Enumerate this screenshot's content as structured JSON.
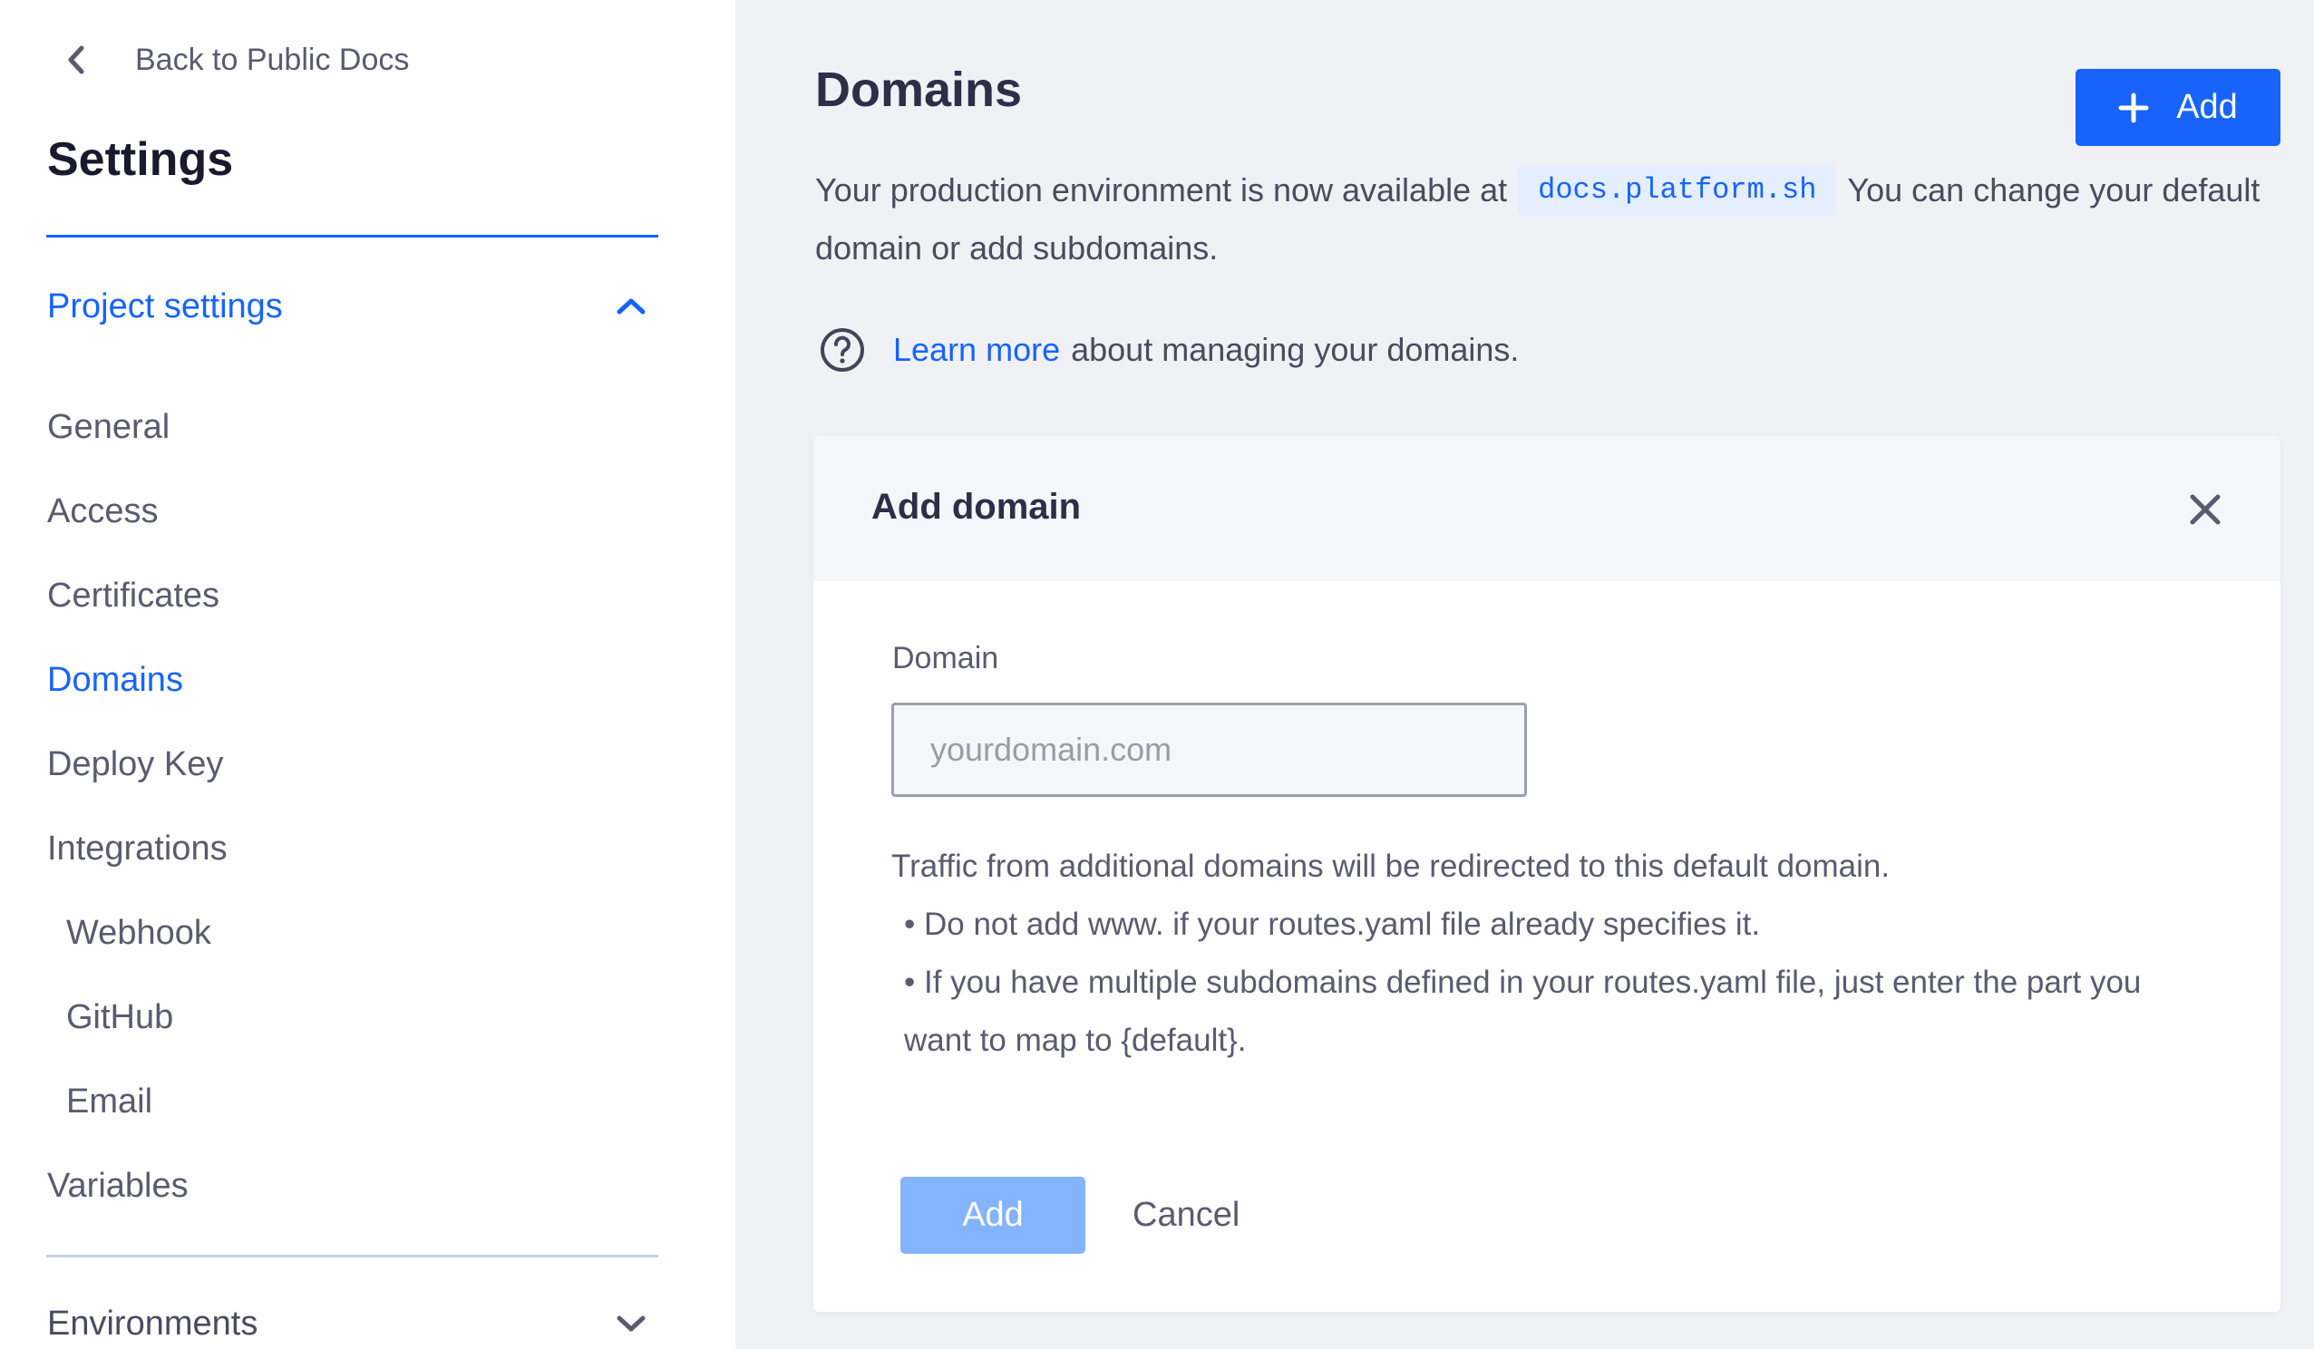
{
  "sidebar": {
    "back_label": "Back to Public Docs",
    "title": "Settings",
    "project_section": {
      "label": "Project settings",
      "expanded": true,
      "items": [
        {
          "label": "General",
          "level": 0,
          "active": false
        },
        {
          "label": "Access",
          "level": 0,
          "active": false
        },
        {
          "label": "Certificates",
          "level": 0,
          "active": false
        },
        {
          "label": "Domains",
          "level": 0,
          "active": true
        },
        {
          "label": "Deploy Key",
          "level": 0,
          "active": false
        },
        {
          "label": "Integrations",
          "level": 0,
          "active": false
        },
        {
          "label": "Webhook",
          "level": 1,
          "active": false
        },
        {
          "label": "GitHub",
          "level": 1,
          "active": false
        },
        {
          "label": "Email",
          "level": 1,
          "active": false
        },
        {
          "label": "Variables",
          "level": 0,
          "active": false
        }
      ]
    },
    "environments_section": {
      "label": "Environments",
      "expanded": false
    }
  },
  "main": {
    "title": "Domains",
    "add_button_label": "Add",
    "intro_before": "Your production environment is now available at",
    "production_domain": "docs.platform.sh",
    "intro_after": "You can change your default domain or add subdomains.",
    "learn_more_link": "Learn more",
    "learn_more_rest": "about managing your domains."
  },
  "add_domain_card": {
    "title": "Add domain",
    "field_label": "Domain",
    "field_value": "",
    "field_placeholder": "yourdomain.com",
    "help_main": "Traffic from additional domains will be redirected to this default domain.",
    "help_bullets": [
      "Do not add www. if your routes.yaml file already specifies it.",
      "If you have multiple subdomains defined in your routes.yaml file, just enter the part you want to map to {default}."
    ],
    "submit_label": "Add",
    "submit_disabled": true,
    "cancel_label": "Cancel"
  },
  "colors": {
    "accent": "#1664ff",
    "primary_button": "#1763fb",
    "disabled_button": "#85b4ff",
    "code_chip_bg": "#e4eefe",
    "page_bg": "#f0f1f5",
    "text": "#4b4a5f",
    "heading": "#2f2d48"
  }
}
